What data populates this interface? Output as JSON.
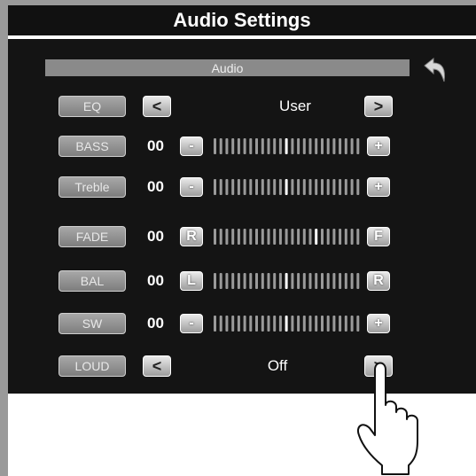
{
  "title": "Audio Settings",
  "section_label": "Audio",
  "rows": [
    {
      "label": "EQ",
      "type": "selector",
      "value": "User",
      "prev": "<",
      "next": ">"
    },
    {
      "label": "BASS",
      "type": "slider",
      "value": "00",
      "left": "-",
      "right": "+",
      "level": 0.5
    },
    {
      "label": "Treble",
      "type": "slider",
      "value": "00",
      "left": "-",
      "right": "+",
      "level": 0.5
    },
    {
      "label": "FADE",
      "type": "slider",
      "value": "00",
      "left": "R",
      "right": "F",
      "level": 0.7
    },
    {
      "label": "BAL",
      "type": "slider",
      "value": "00",
      "left": "L",
      "right": "R",
      "level": 0.5
    },
    {
      "label": "SW",
      "type": "slider",
      "value": "00",
      "left": "-",
      "right": "+",
      "level": 0.5
    },
    {
      "label": "LOUD",
      "type": "selector",
      "value": "Off",
      "prev": "<",
      "next": ">"
    }
  ],
  "icons": {
    "back": "back-arrow-icon",
    "pointer": "hand-pointer-icon"
  }
}
